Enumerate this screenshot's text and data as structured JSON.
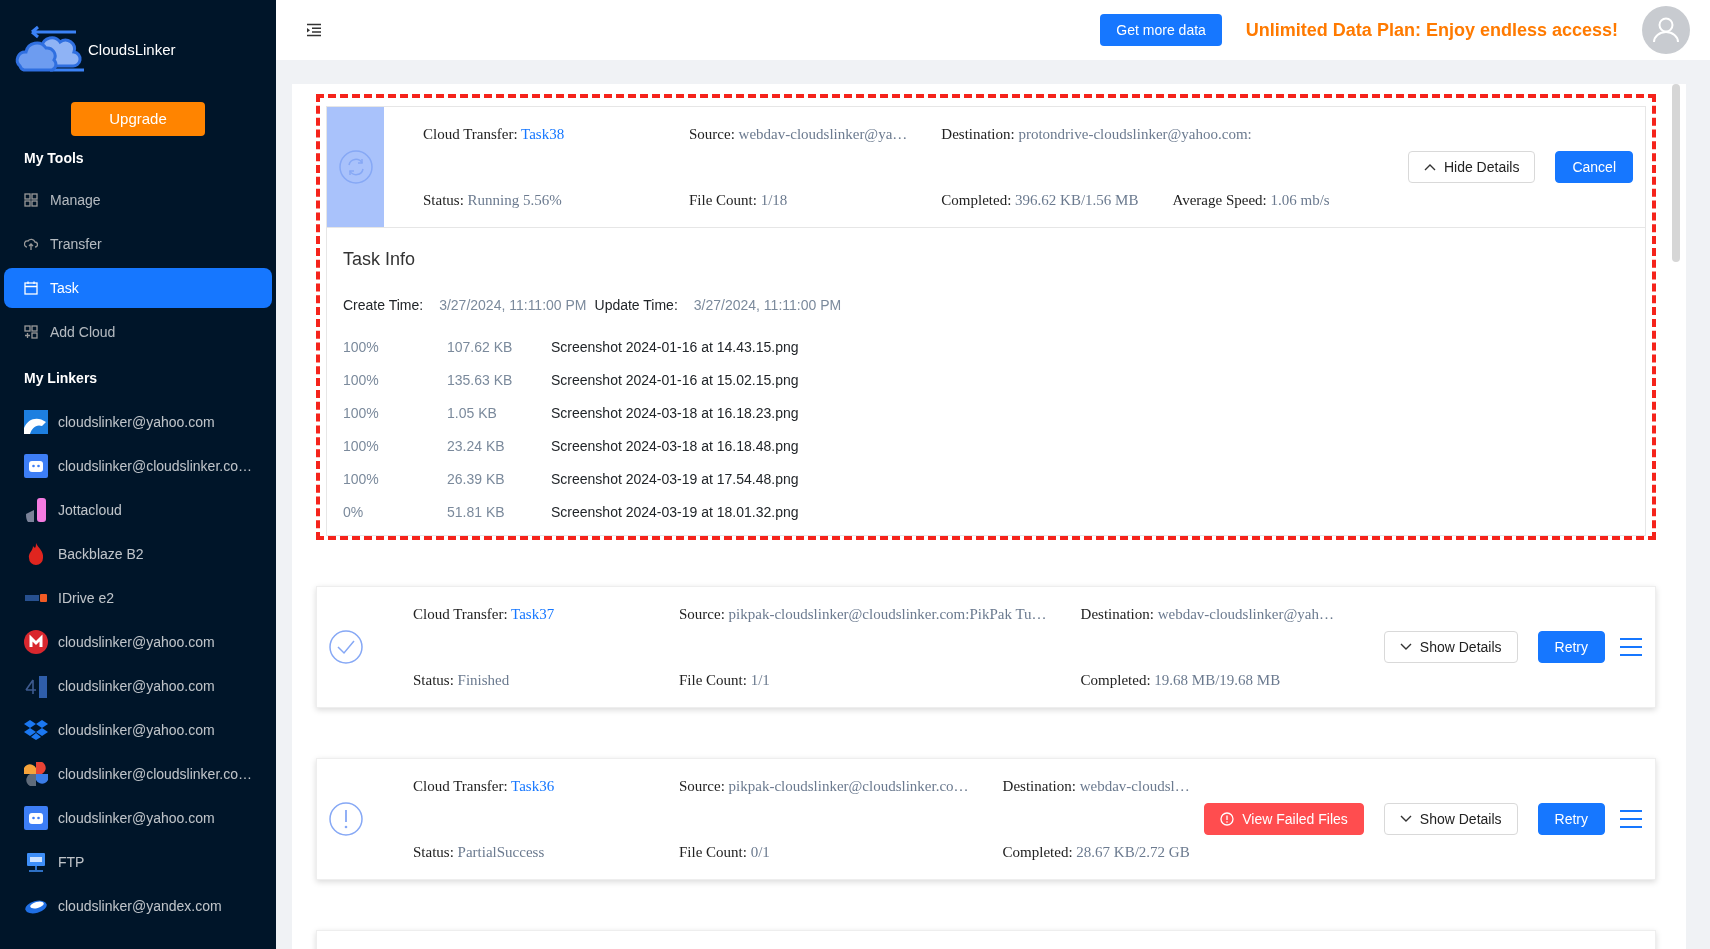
{
  "app": {
    "name": "CloudsLinker",
    "upgrade_button": "Upgrade"
  },
  "sidebar": {
    "sections": [
      {
        "title": "My Tools",
        "items": [
          {
            "label": "Manage",
            "kind": "grid",
            "selected": false
          },
          {
            "label": "Transfer",
            "kind": "upload",
            "selected": false
          },
          {
            "label": "Task",
            "kind": "calendar",
            "selected": true
          },
          {
            "label": "Add Cloud",
            "kind": "gridplus",
            "selected": false
          }
        ]
      },
      {
        "title": "My Linkers",
        "items": [
          {
            "label": "cloudslinker@yahoo.com",
            "kind": "bear"
          },
          {
            "label": "cloudslinker@cloudslinker.co…",
            "kind": "robot"
          },
          {
            "label": "Jottacloud",
            "kind": "jotta"
          },
          {
            "label": "Backblaze B2",
            "kind": "flame"
          },
          {
            "label": "IDrive e2",
            "kind": "idrive"
          },
          {
            "label": "cloudslinker@yahoo.com",
            "kind": "mega"
          },
          {
            "label": "cloudslinker@yahoo.com",
            "kind": "four"
          },
          {
            "label": "cloudslinker@yahoo.com",
            "kind": "dropbox"
          },
          {
            "label": "cloudslinker@cloudslinker.co…",
            "kind": "pinwheel"
          },
          {
            "label": "cloudslinker@yahoo.com",
            "kind": "robot"
          },
          {
            "label": "FTP",
            "kind": "ftp"
          },
          {
            "label": "cloudslinker@yandex.com",
            "kind": "disc"
          }
        ]
      }
    ]
  },
  "header": {
    "get_data_button": "Get more data",
    "promo": "Unlimited Data Plan: Enjoy endless access!"
  },
  "tasks": [
    {
      "kind": "running",
      "highlighted": true,
      "level": 0.043,
      "row_1": [
        {
          "label": "Cloud Transfer:",
          "value": "Task38",
          "kind": "link"
        },
        {
          "label": "Source:",
          "value": "webdav-cloudslinker@ya…"
        },
        {
          "label": "Destination:",
          "value": "protondrive-cloudslinker@yahoo.com:"
        }
      ],
      "row_2": [
        {
          "label": "Status:",
          "value": "Running 5.56%"
        },
        {
          "label": "File Count:",
          "value": "1/18"
        },
        {
          "label": "Completed:",
          "value": "396.62 KB/1.56 MB"
        },
        {
          "label": "Average Speed:",
          "value": "1.06 mb/s"
        }
      ],
      "buttons": [
        {
          "kind": "toggle",
          "label": "Hide Details",
          "expanded": true
        },
        {
          "kind": "primary",
          "label": "Cancel"
        }
      ],
      "menu": false,
      "details": {
        "title": "Task Info",
        "create_label": "Create Time:",
        "create_value": "3/27/2024, 11:11:00 PM",
        "update_label": "Update Time:",
        "update_value": "3/27/2024, 11:11:00 PM",
        "files": [
          {
            "progress": "100%",
            "size": "107.62 KB",
            "name": "Screenshot 2024-01-16 at 14.43.15.png"
          },
          {
            "progress": "100%",
            "size": "135.63 KB",
            "name": "Screenshot 2024-01-16 at 15.02.15.png"
          },
          {
            "progress": "100%",
            "size": "1.05 KB",
            "name": "Screenshot 2024-03-18 at 16.18.23.png"
          },
          {
            "progress": "100%",
            "size": "23.24 KB",
            "name": "Screenshot 2024-03-18 at 16.18.48.png"
          },
          {
            "progress": "100%",
            "size": "26.39 KB",
            "name": "Screenshot 2024-03-19 at 17.54.48.png"
          },
          {
            "progress": "0%",
            "size": "51.81 KB",
            "name": "Screenshot 2024-03-19 at 18.01.32.png"
          }
        ]
      }
    },
    {
      "kind": "finished",
      "highlighted": false,
      "row_1": [
        {
          "label": "Cloud Transfer:",
          "value": "Task37",
          "kind": "link"
        },
        {
          "label": "Source:",
          "value": "pikpak-cloudslinker@cloudslinker.com:PikPak Tu…"
        },
        {
          "label": "Destination:",
          "value": "webdav-cloudslinker@yah…"
        }
      ],
      "row_2": [
        {
          "label": "Status:",
          "value": "Finished"
        },
        {
          "label": "File Count:",
          "value": "1/1"
        },
        {
          "label": "Completed:",
          "value": "19.68 MB/19.68 MB"
        }
      ],
      "buttons": [
        {
          "kind": "toggle",
          "label": "Show Details",
          "expanded": false
        },
        {
          "kind": "primary",
          "label": "Retry"
        }
      ],
      "menu": true
    },
    {
      "kind": "partial",
      "highlighted": false,
      "row_1": [
        {
          "label": "Cloud Transfer:",
          "value": "Task36",
          "kind": "link"
        },
        {
          "label": "Source:",
          "value": "pikpak-cloudslinker@cloudslinker.co…"
        },
        {
          "label": "Destination:",
          "value": "webdav-cloudsl…"
        }
      ],
      "row_2": [
        {
          "label": "Status:",
          "value": "PartialSuccess"
        },
        {
          "label": "File Count:",
          "value": "0/1"
        },
        {
          "label": "Completed:",
          "value": "28.67 KB/2.72 GB"
        }
      ],
      "buttons": [
        {
          "kind": "danger",
          "label": "View Failed Files"
        },
        {
          "kind": "toggle",
          "label": "Show Details",
          "expanded": false
        },
        {
          "kind": "primary",
          "label": "Retry"
        }
      ],
      "menu": true
    }
  ]
}
